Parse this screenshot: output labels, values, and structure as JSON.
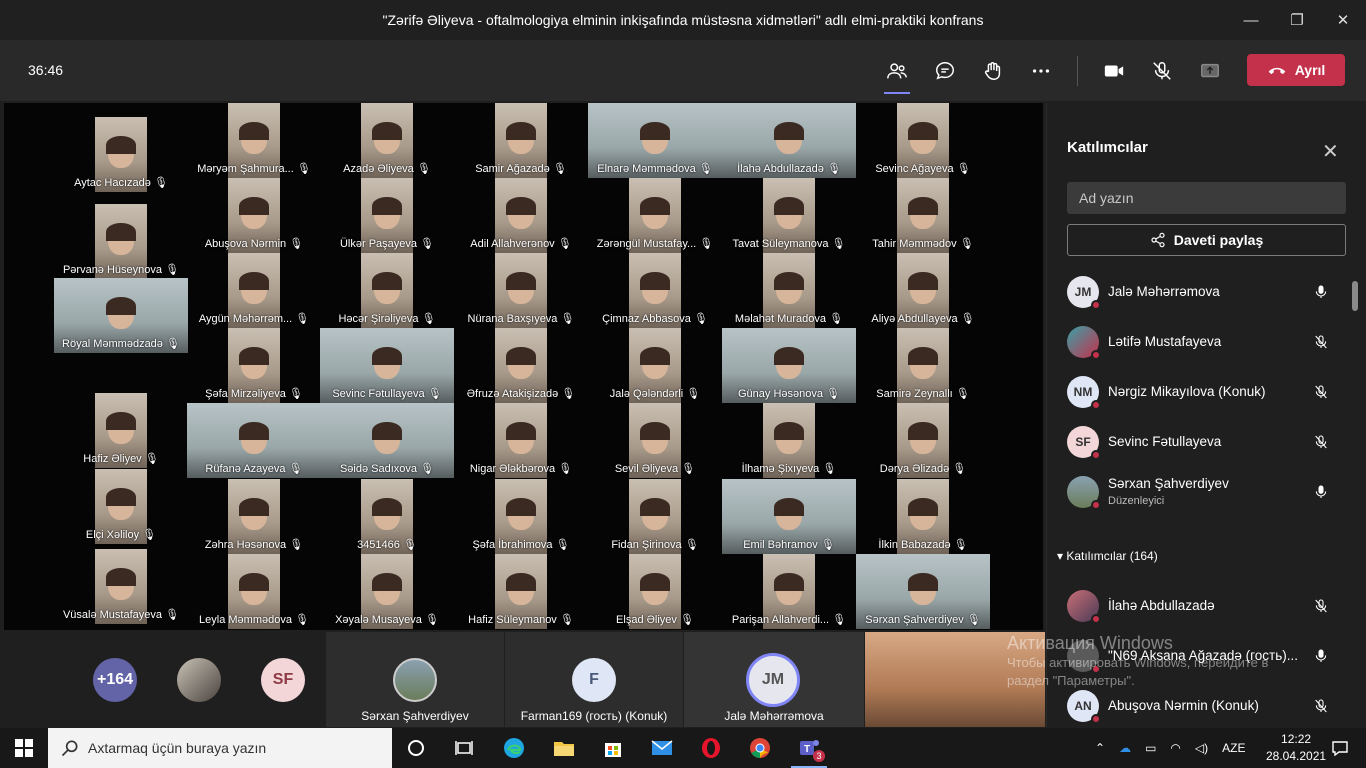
{
  "window": {
    "title": "\"Zərifə Əliyeva - oftalmologiya elminin inkişafında müstəsna xidmətləri\" adlı elmi-praktiki konfrans",
    "minimize": "—",
    "maximize": "❐",
    "close": "✕"
  },
  "toolbar": {
    "timer": "36:46",
    "leave_label": "Ayrıl"
  },
  "gallery": [
    {
      "name": "Aytac Hacızadə"
    },
    {
      "name": "Məryəm Şahmura..."
    },
    {
      "name": "Azadə Əliyeva"
    },
    {
      "name": "Samir Ağazadə"
    },
    {
      "name": "Elnarə Məmmədova"
    },
    {
      "name": "İlahə Abdullazadə"
    },
    {
      "name": "Sevinc Ağayeva"
    },
    {
      "name": "Abuşova Nərmin"
    },
    {
      "name": "Ülkər Paşayeva"
    },
    {
      "name": "Adil Allahverənov"
    },
    {
      "name": "Zərəngül Mustafay..."
    },
    {
      "name": "Tavat Süleymanova"
    },
    {
      "name": "Tahir Məmmədov"
    },
    {
      "name": "Pərvanə Hüseynova"
    },
    {
      "name": "Aygün Məhərrəm..."
    },
    {
      "name": "Həcər Şirəliyeva"
    },
    {
      "name": "Nürana Baxşıyeva"
    },
    {
      "name": "Çimnaz Abbasova"
    },
    {
      "name": "Məlahət Muradova"
    },
    {
      "name": "Aliyə Abdullayeva"
    },
    {
      "name": "Röyal Məmmədzadə"
    },
    {
      "name": "Şəfa Mirzəliyeva"
    },
    {
      "name": "Sevinc Fətullayeva"
    },
    {
      "name": "Əfruzə Atakişizadə"
    },
    {
      "name": "Jalə Qələndərli"
    },
    {
      "name": "Günay Həsənova"
    },
    {
      "name": "Samirə Zeynallı"
    },
    {
      "name": "Hafiz Əliyev"
    },
    {
      "name": "Rüfanə Azayeva"
    },
    {
      "name": "Səidə Sadıxova"
    },
    {
      "name": "Nigar Ələkbərova"
    },
    {
      "name": "Sevil Əliyeva"
    },
    {
      "name": "İlhamə Şixıyeva"
    },
    {
      "name": "Dərya Əlizadə"
    },
    {
      "name": "Elçi Xəliloy"
    },
    {
      "name": "Zəhra Həsənova"
    },
    {
      "name": "3451466"
    },
    {
      "name": "Şəfa İbrahimova"
    },
    {
      "name": "Fidan Şirinova"
    },
    {
      "name": "Emil Bəhramov"
    },
    {
      "name": "İlkin Babazadə"
    },
    {
      "name": "Vüsalə Mustafayeva"
    },
    {
      "name": "Leyla Məmmədova"
    },
    {
      "name": "Xəyalə Musayeva"
    },
    {
      "name": "Hafiz Süleymanov"
    },
    {
      "name": "Elşad Əliyev"
    },
    {
      "name": "Parişan Allahverdi..."
    },
    {
      "name": "Sərxan Şahverdiyev"
    }
  ],
  "strip": {
    "overflow_count": "+164",
    "sf_initials": "SF",
    "tile1_name": "Sərxan Şahverdiyev",
    "tile2_initial": "F",
    "tile2_name": "Farman169 (гость) (Konuk)",
    "tile3_initials": "JM",
    "tile3_name": "Jalə Məhərrəmova"
  },
  "panel": {
    "title": "Katılımcılar",
    "search_placeholder": "Ad yazın",
    "share_label": "Daveti paylaş",
    "section_label": "Katılımcılar (164)",
    "people": [
      {
        "initials": "JM",
        "name": "Jalə Məhərrəmova",
        "role": "",
        "mic": "on"
      },
      {
        "initials": "",
        "name": "Lətifə Mustafayeva",
        "role": "",
        "mic": "off"
      },
      {
        "initials": "NM",
        "name": "Nərgiz Mikayılova (Konuk)",
        "role": "",
        "mic": "off"
      },
      {
        "initials": "SF",
        "name": "Sevinc Fətullayeva",
        "role": "",
        "mic": "off"
      },
      {
        "initials": "",
        "name": "Sərxan Şahverdiyev",
        "role": "Düzenleyici",
        "mic": "on"
      },
      {
        "initials": "",
        "name": "İlahə Abdullazadə",
        "role": "",
        "mic": "off"
      },
      {
        "initials": "",
        "name": "\"N69 Aksana Ağazadə (гость)...",
        "role": "",
        "mic": "on"
      },
      {
        "initials": "AN",
        "name": "Abuşova Nərmin (Konuk)",
        "role": "",
        "mic": "off"
      }
    ]
  },
  "watermark": {
    "line1": "Активация Windows",
    "line2": "Чтобы активировать Windows, перейдите в",
    "line3": "раздел \"Параметры\"."
  },
  "taskbar": {
    "search_placeholder": "Axtarmaq üçün buraya yazın",
    "language": "AZE",
    "time": "12:22",
    "date": "28.04.2021",
    "teams_badge": "3"
  },
  "colors": {
    "accent": "#7f85f5",
    "leave": "#c4314b",
    "panel_bg": "#1f1f1f"
  }
}
